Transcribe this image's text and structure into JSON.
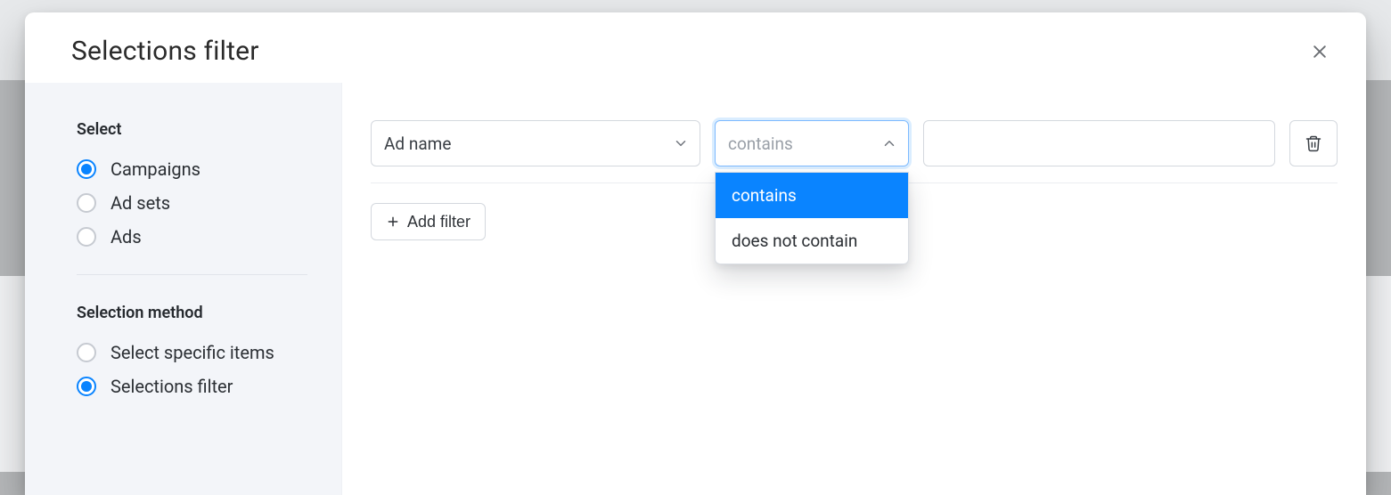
{
  "header": {
    "title": "Selections filter"
  },
  "sidebar": {
    "section1_title": "Select",
    "select_options": [
      {
        "label": "Campaigns",
        "checked": true
      },
      {
        "label": "Ad sets",
        "checked": false
      },
      {
        "label": "Ads",
        "checked": false
      }
    ],
    "section2_title": "Selection method",
    "method_options": [
      {
        "label": "Select specific items",
        "checked": false
      },
      {
        "label": "Selections filter",
        "checked": true
      }
    ]
  },
  "filter": {
    "field_value": "Ad name",
    "operator_placeholder": "contains",
    "value": "",
    "operator_options": [
      {
        "label": "contains",
        "selected": true
      },
      {
        "label": "does not contain",
        "selected": false
      }
    ]
  },
  "buttons": {
    "add_filter": "Add filter"
  }
}
